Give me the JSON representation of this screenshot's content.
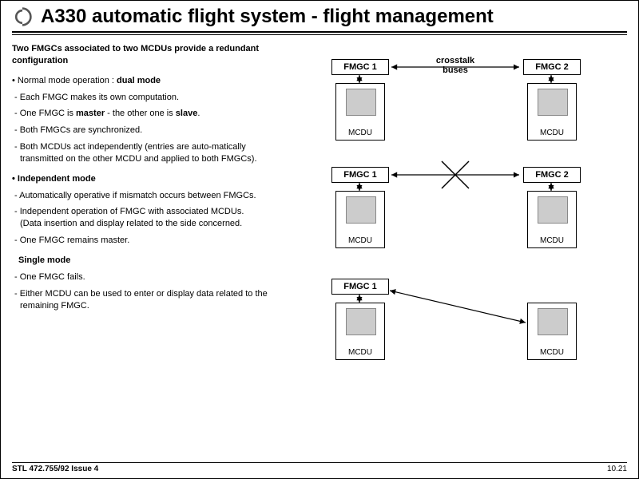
{
  "header": {
    "title": "A330 automatic flight system - flight management"
  },
  "text": {
    "lead": "Two FMGCs associated to two MCDUs provide a redundant configuration",
    "normal_mode_prefix": "• Normal mode operation : ",
    "normal_mode_bold": "dual mode",
    "normal_1": "Each FMGC makes its own computation.",
    "normal_2a": "One FMGC is ",
    "normal_2b": "master",
    "normal_2c": " - the other one is ",
    "normal_2d": "slave",
    "normal_2e": ".",
    "normal_3": "Both FMGCs are synchronized.",
    "normal_4": "Both MCDUs act independently (entries are auto-matically transmitted on the other MCDU and applied to both FMGCs).",
    "independent_head": "• Independent mode",
    "independent_1": "Automatically operative if mismatch occurs between FMGCs.",
    "independent_2": "Independent operation of FMGC with associated MCDUs.\n(Data insertion and display related to the side concerned.",
    "independent_3": "One FMGC remains master.",
    "single_head": "Single mode",
    "single_1": "One FMGC fails.",
    "single_2": "Either MCDU can be used to enter or display data related to the remaining FMGC."
  },
  "diagram": {
    "fmgc1": "FMGC 1",
    "fmgc2": "FMGC 2",
    "mcdu": "MCDU",
    "crosstalk_line1": "crosstalk",
    "crosstalk_line2": "buses"
  },
  "footer": {
    "left": "STL 472.755/92 Issue 4",
    "right": "10.21"
  }
}
